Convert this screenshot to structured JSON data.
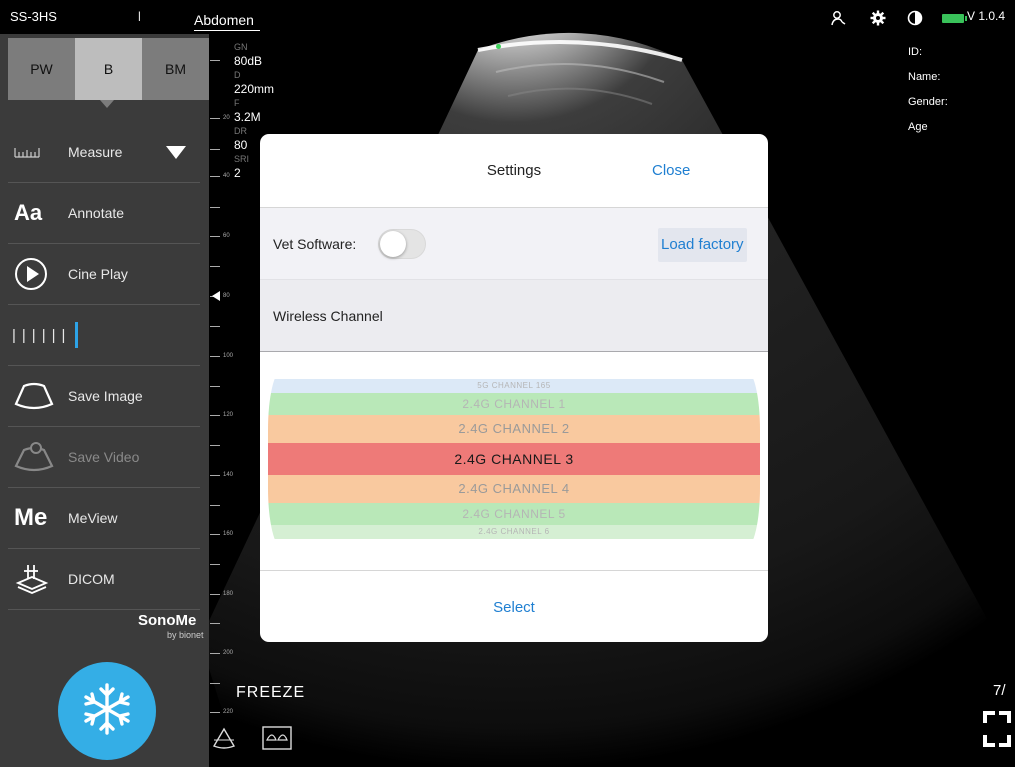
{
  "topbar": {
    "probe": "SS-3HS",
    "separator": "l",
    "preset": "Abdomen",
    "version": "V 1.0.4",
    "icons": [
      "person-icon",
      "gear-icon",
      "contrast-icon",
      "battery-icon"
    ],
    "battery_color": "#39c25a"
  },
  "sidebar": {
    "modes": [
      "PW",
      "B",
      "BM"
    ],
    "active_mode": "B",
    "menu": [
      {
        "label": "Measure",
        "icon": "ruler-icon"
      },
      {
        "label": "Annotate",
        "icon": "annotate-icon",
        "icon_text": "Aa"
      },
      {
        "label": "Cine Play",
        "icon": "play-icon"
      },
      {
        "label": "Save Image",
        "icon": "probe-image-icon"
      },
      {
        "label": "Save Video",
        "icon": "probe-video-icon"
      },
      {
        "label": "MeView",
        "icon": "meview-icon",
        "icon_text": "Me"
      },
      {
        "label": "DICOM",
        "icon": "dicom-icon"
      }
    ],
    "brand": "SonoMe",
    "brand_sub": "by bionet",
    "freeze_color": "#34aee6"
  },
  "params": {
    "gn_label": "GN",
    "gn_value": "80dB",
    "d_label": "D",
    "d_value": "220mm",
    "f_label": "F",
    "f_value": "3.2M",
    "dr_label": "DR",
    "dr_value": "80",
    "sri_label": "SRI",
    "sri_value": "2"
  },
  "depth_scale": [
    "20",
    "40",
    "60",
    "80",
    "100",
    "120",
    "140",
    "160",
    "180",
    "200",
    "220"
  ],
  "freeze_label": "FREEZE",
  "patient": {
    "id_label": "ID:",
    "name_label": "Name:",
    "gender_label": "Gender:",
    "age_label": "Age"
  },
  "frame_count": "7/",
  "settings": {
    "title": "Settings",
    "close": "Close",
    "vet_label": "Vet Software:",
    "vet_enabled": false,
    "load_factory": "Load factory",
    "wireless_label": "Wireless Channel",
    "select": "Select",
    "accent_color": "#1f7fd1",
    "channels": [
      {
        "label": "5G CHANNEL 165",
        "band": "#dce9f7"
      },
      {
        "label": "2.4G CHANNEL 1",
        "band": "#b9e8b8"
      },
      {
        "label": "2.4G CHANNEL 2",
        "band": "#f9c99f"
      },
      {
        "label": "2.4G CHANNEL 3",
        "band": "#ee7a78"
      },
      {
        "label": "2.4G CHANNEL 4",
        "band": "#f9c99f"
      },
      {
        "label": "2.4G CHANNEL 5",
        "band": "#b9e8b8"
      },
      {
        "label": "2.4G CHANNEL 6",
        "band": "#d5efd3"
      }
    ],
    "selected_channel": "2.4G CHANNEL 3"
  }
}
